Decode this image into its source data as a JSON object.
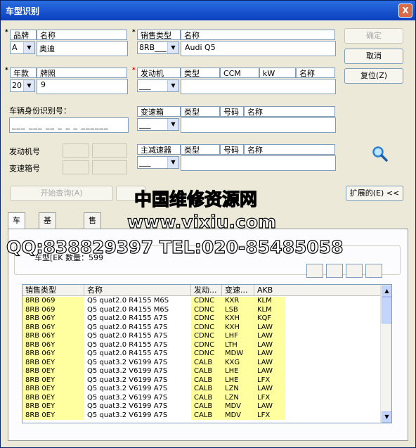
{
  "window": {
    "title": "车型识别",
    "close": "X"
  },
  "buttons": {
    "ok": "确定",
    "cancel": "取消",
    "reset": "复位(Z)",
    "start_query": "开始查询(A)",
    "expand": "扩展的(E) <<"
  },
  "brand": {
    "label": "品牌",
    "name_label": "名称",
    "code": "A",
    "name": "奥迪"
  },
  "sales_type": {
    "label": "销售类型",
    "name_label": "名称",
    "code": "8RB___",
    "name": "Audi Q5"
  },
  "year": {
    "label": "年款",
    "plate_label": "牌照",
    "code": "20",
    "plate": "9"
  },
  "engine": {
    "label": "发动机",
    "type_label": "类型",
    "ccm_label": "CCM",
    "kw_label": "kW",
    "name_label": "名称",
    "code": "___"
  },
  "vin": {
    "label": "车辆身份识别号："
  },
  "gearbox": {
    "label": "变速箱",
    "type_label": "类型",
    "number_label": "号码",
    "name_label": "名称",
    "code": "___"
  },
  "engine_no": {
    "label": "发动机号"
  },
  "gearbox_no": {
    "label": "变速箱号"
  },
  "final_drive": {
    "label": "主减速器",
    "type_label": "类型",
    "number_label": "号码",
    "name_label": "名称",
    "code": "___"
  },
  "tabs": [
    "车型",
    "基本数据",
    "售后服务数据"
  ],
  "panel": {
    "group_label": "车型[EK 数量：599"
  },
  "watermark": {
    "line1": "中国维修资源网",
    "line2": "www.vixiu.com",
    "line3": "QQ:838829397 TEL:020-85485058"
  },
  "table": {
    "columns": [
      "销售类型",
      "名称",
      "发动...",
      "变速...",
      "AKB"
    ],
    "rows": [
      [
        "8RB 069",
        "Q5 quat2.0 R4155 M6S",
        "CDNC",
        "KXR",
        "KLM"
      ],
      [
        "8RB 069",
        "Q5 quat2.0 R4155 M6S",
        "CDNC",
        "LSB",
        "KLM"
      ],
      [
        "8RB 06Y",
        "Q5 quat2.0 R4155 A7S",
        "CDNC",
        "KXH",
        "KQF"
      ],
      [
        "8RB 06Y",
        "Q5 quat2.0 R4155 A7S",
        "CDNC",
        "KXH",
        "LAW"
      ],
      [
        "8RB 06Y",
        "Q5 quat2.0 R4155 A7S",
        "CDNC",
        "LHF",
        "LAW"
      ],
      [
        "8RB 06Y",
        "Q5 quat2.0 R4155 A7S",
        "CDNC",
        "LTH",
        "LAW"
      ],
      [
        "8RB 06Y",
        "Q5 quat2.0 R4155 A7S",
        "CDNC",
        "MDW",
        "LAW"
      ],
      [
        "8RB 0EY",
        "Q5 quat3.2 V6199 A7S",
        "CALB",
        "KXG",
        "LAW"
      ],
      [
        "8RB 0EY",
        "Q5 quat3.2 V6199 A7S",
        "CALB",
        "LHE",
        "LAW"
      ],
      [
        "8RB 0EY",
        "Q5 quat3.2 V6199 A7S",
        "CALB",
        "LHE",
        "LFX"
      ],
      [
        "8RB 0EY",
        "Q5 quat3.2 V6199 A7S",
        "CALB",
        "LZN",
        "LAW"
      ],
      [
        "8RB 0EY",
        "Q5 quat3.2 V6199 A7S",
        "CALB",
        "LZN",
        "LFX"
      ],
      [
        "8RB 0EY",
        "Q5 quat3.2 V6199 A7S",
        "CALB",
        "MDV",
        "LAW"
      ],
      [
        "8RB 0EY",
        "Q5 quat3.2 V6199 A7S",
        "CALB",
        "MDV",
        "LFX"
      ]
    ]
  },
  "icons": {
    "search": "magnifier-icon"
  }
}
